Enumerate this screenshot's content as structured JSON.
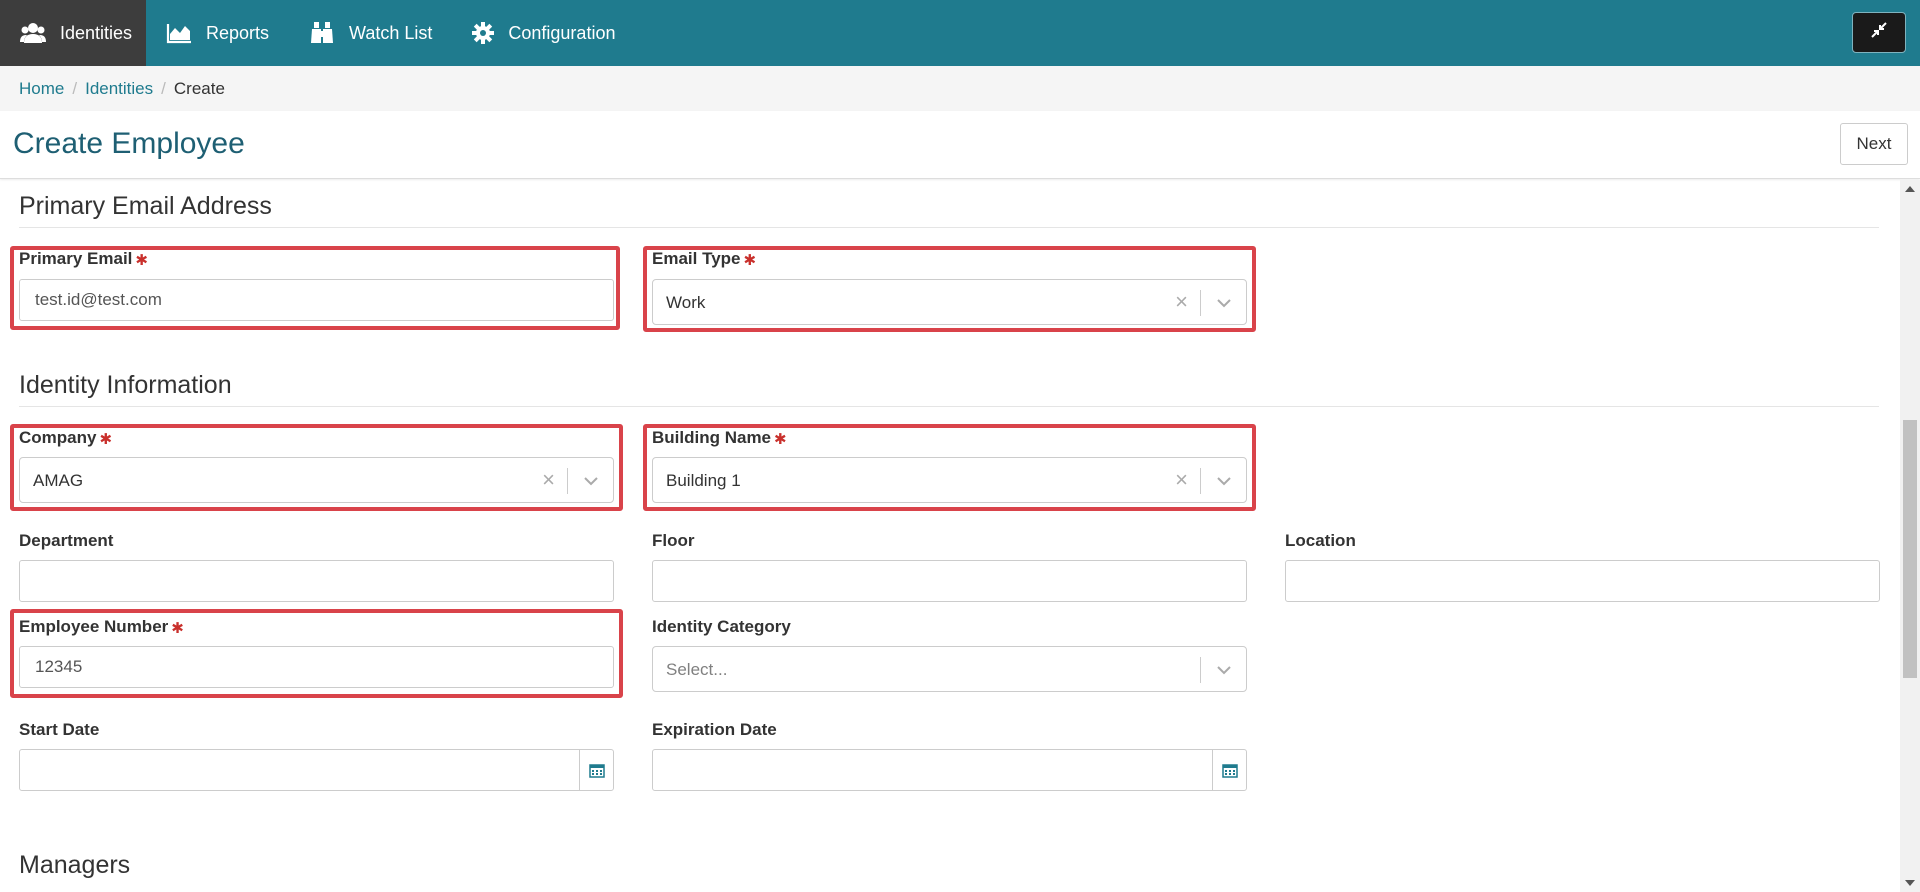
{
  "nav": {
    "items": [
      {
        "label": "Identities",
        "icon": "users-icon",
        "active": true
      },
      {
        "label": "Reports",
        "icon": "area-chart-icon"
      },
      {
        "label": "Watch List",
        "icon": "binoculars-icon"
      },
      {
        "label": "Configuration",
        "icon": "gear-icon"
      }
    ],
    "collapse_icon": "compress-icon"
  },
  "breadcrumb": {
    "home": "Home",
    "identities": "Identities",
    "current": "Create",
    "separator": "/"
  },
  "header": {
    "title": "Create Employee",
    "next_label": "Next"
  },
  "sections": {
    "email": {
      "title": "Primary Email Address",
      "primary_email": {
        "label": "Primary Email",
        "value": "test.id@test.com"
      },
      "email_type": {
        "label": "Email Type",
        "value": "Work"
      }
    },
    "identity": {
      "title": "Identity Information",
      "company": {
        "label": "Company",
        "value": "AMAG"
      },
      "building": {
        "label": "Building Name",
        "value": "Building 1"
      },
      "department": {
        "label": "Department",
        "value": ""
      },
      "floor": {
        "label": "Floor",
        "value": ""
      },
      "location": {
        "label": "Location",
        "value": ""
      },
      "employee_number": {
        "label": "Employee Number",
        "value": "12345"
      },
      "identity_category": {
        "label": "Identity Category",
        "placeholder": "Select..."
      },
      "start_date": {
        "label": "Start Date",
        "value": ""
      },
      "expiration_date": {
        "label": "Expiration Date",
        "value": ""
      }
    },
    "managers": {
      "title": "Managers"
    }
  },
  "required_marker": "✱",
  "clear_glyph": "×",
  "colors": {
    "nav_bg": "#1f7b8e",
    "nav_active": "#3d3d3d",
    "title": "#1e5f73",
    "highlight": "#d9434a",
    "required": "#c9302c"
  }
}
